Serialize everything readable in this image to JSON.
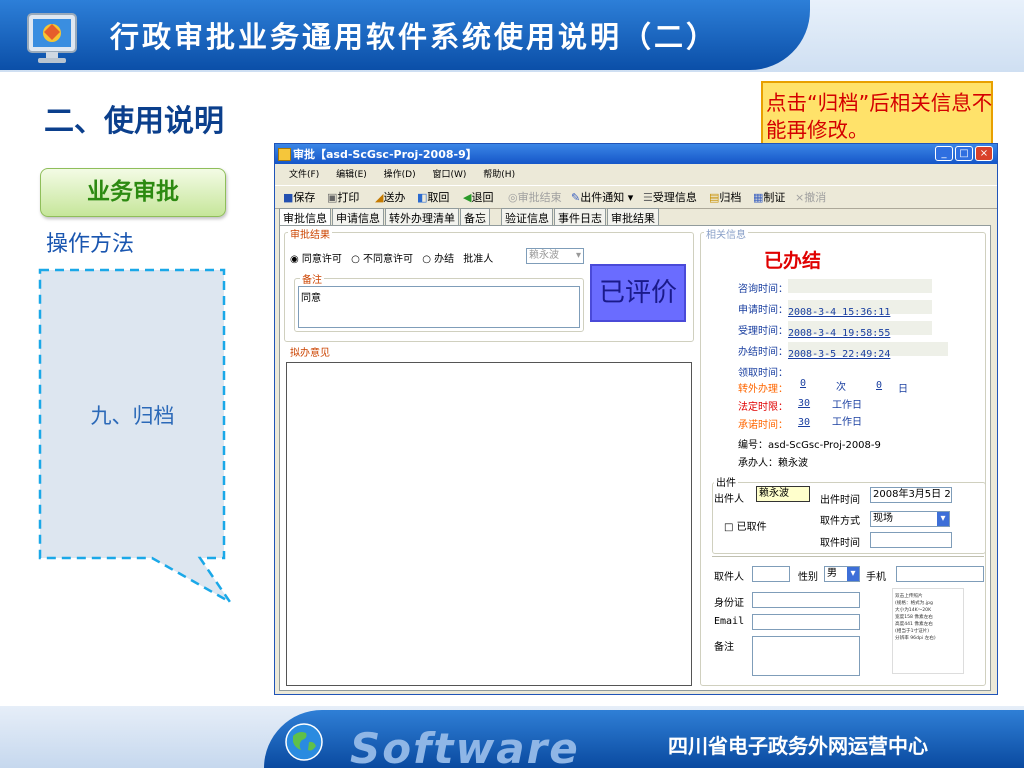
{
  "slide": {
    "title": "行政审批业务通用软件系统使用说明（二）",
    "section_title": "二、使用说明",
    "category_label": "业务审批",
    "method_label": "操作方法",
    "step_label": "九、归档",
    "callout_text": "点击“归档”后相关信息不能再修改。",
    "footer_logo_text": "Software",
    "footer_org": "四川省电子政务外网运营中心"
  },
  "window": {
    "title": "审批【asd-ScGsc-Proj-2008-9】",
    "controls": [
      "_",
      "□",
      "×"
    ],
    "menu": [
      "文件(F)",
      "编辑(E)",
      "操作(D)",
      "窗口(W)",
      "帮助(H)"
    ],
    "toolbar": [
      "保存",
      "打印",
      "送办",
      "取回",
      "退回",
      "审批结束",
      "出件通知 ▾",
      "受理信息",
      "归档",
      "制证",
      "撤消"
    ],
    "tabs": [
      "审批信息",
      "申请信息",
      "转外办理清单",
      "备忘",
      "验证信息",
      "事件日志",
      "审批结果"
    ],
    "approval": {
      "group_label": "审批结果",
      "options": [
        "同意许可",
        "不同意许可",
        "办结"
      ],
      "approver_label": "批准人",
      "approver_value": "赖永波",
      "remark_label": "备注",
      "remark_value": "同意",
      "rated_stamp": "已评价",
      "opinion_label": "拟办意见"
    },
    "info": {
      "group_label": "相关信息",
      "status": "已办结",
      "consult_label": "咨询时间：",
      "apply_label": "申请时间：",
      "apply_value": "2008-3-4 15:36:11",
      "accept_label": "受理时间：",
      "accept_value": "2008-3-4 19:58:55",
      "finish_label": "办结时间：",
      "finish_value": "2008-3-5 22:49:24",
      "pickup_label": "领取时间：",
      "transfer_label": "转外办理：",
      "transfer_count": "0",
      "transfer_unit": "次",
      "transfer_days": "0",
      "day_unit": "日",
      "legal_label": "法定时限：",
      "legal_value": "30",
      "promise_label": "承诺时间：",
      "promise_value": "30",
      "workday_unit": "工作日",
      "number_line": "编号：asd-ScGsc-Proj-2008-9",
      "handler_line": "承办人：赖永波"
    },
    "issue": {
      "group_label": "出件",
      "person_label": "出件人",
      "person_value": "赖永波",
      "time_label": "出件时间",
      "time_value": "2008年3月5日 2",
      "picked_label": "已取件",
      "method_label": "取件方式",
      "method_value": "现场",
      "pick_time_label": "取件时间",
      "receiver_label": "取件人",
      "gender_label": "性别",
      "gender_value": "男",
      "phone_label": "手机",
      "id_label": "身份证",
      "email_label": "Email",
      "note_label": "备注",
      "photo_hint": "双击上传照片\n(规格：格式为.jpg\n大小为14K～20K\n宽度158 像素左右\n高度441 像素左右\n(相当于1寸证片)\n分辨率 96dpi 左右)"
    }
  },
  "colors": {
    "header_blue": "#0b4fa8",
    "callout_red": "#d40000",
    "stamp_purple": "#6a6cff"
  }
}
